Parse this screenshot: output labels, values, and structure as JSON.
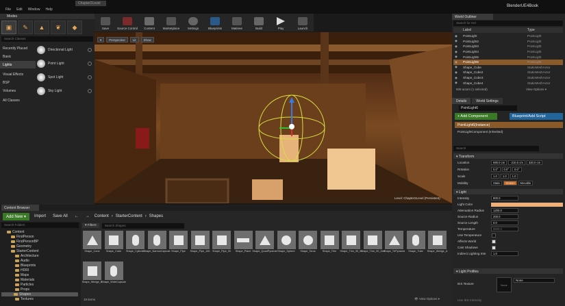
{
  "app": {
    "project_tab": "Chapter2Level",
    "project_name": "BlenderUE4Book",
    "menu": [
      "File",
      "Edit",
      "Window",
      "Help"
    ]
  },
  "toolbar": {
    "buttons": [
      "Save",
      "Source Control",
      "Content",
      "Marketplace",
      "Settings",
      "Blueprints",
      "Matinee",
      "Build",
      "Play",
      "Launch"
    ]
  },
  "modes": {
    "title": "Modes",
    "search_placeholder": "Search Classes",
    "categories": [
      "Recently Placed",
      "Basic",
      "Lights",
      "Visual Effects",
      "BSP",
      "Volumes",
      "All Classes"
    ],
    "lights": [
      "Directional Light",
      "Point Light",
      "Spot Light",
      "Sky Light"
    ]
  },
  "viewport": {
    "perspective": "Perspective",
    "lit": "Lit",
    "show": "Show",
    "level_text": "Level: Chapter2Level (Persistent)"
  },
  "content_browser": {
    "tab": "Content Browser",
    "add_new": "Add New",
    "import": "Import",
    "save_all": "Save All",
    "path": [
      "Content",
      "StarterContent",
      "Shapes"
    ],
    "folder_search": "Search Folders",
    "filters": "Filters",
    "asset_search": "Search Shapes",
    "folders": [
      {
        "name": "Content",
        "depth": 0
      },
      {
        "name": "FirstPerson",
        "depth": 1
      },
      {
        "name": "FirstPersonBP",
        "depth": 1
      },
      {
        "name": "Geometry",
        "depth": 1
      },
      {
        "name": "StarterContent",
        "depth": 1
      },
      {
        "name": "Architecture",
        "depth": 2
      },
      {
        "name": "Audio",
        "depth": 2
      },
      {
        "name": "Blueprints",
        "depth": 2
      },
      {
        "name": "HDRI",
        "depth": 2
      },
      {
        "name": "Maps",
        "depth": 2
      },
      {
        "name": "Materials",
        "depth": 2
      },
      {
        "name": "Particles",
        "depth": 2
      },
      {
        "name": "Props",
        "depth": 2
      },
      {
        "name": "Shapes",
        "depth": 2,
        "selected": true
      },
      {
        "name": "Textures",
        "depth": 2
      }
    ],
    "assets": [
      "Shape_Cone",
      "Shape_Cube",
      "Shape_Cylinder",
      "Shape_NarrowCapsule",
      "Shape_Pipe",
      "Shape_Pipe_180",
      "Shape_Pipe_90",
      "Shape_Plane",
      "Shape_QuadPyramid",
      "Shape_Sphere",
      "Shape_Torus",
      "Shape_Trim",
      "Shape_Trim_90_In",
      "Shape_Trim_90_Out",
      "Shape_TriPyramid",
      "Shape_Tube",
      "Shape_Wedge_A",
      "Shape_Wedge_B",
      "Shape_WideCapsule"
    ],
    "item_count": "19 items",
    "view_options": "View Options"
  },
  "world_outliner": {
    "tab": "World Outliner",
    "search_placeholder": "Search for Hel",
    "col_label": "Label",
    "col_type": "Type",
    "rows": [
      {
        "label": "PointLight",
        "type": "PointLight"
      },
      {
        "label": "PointLight2",
        "type": "PointLight"
      },
      {
        "label": "PointLight3",
        "type": "PointLight"
      },
      {
        "label": "PointLight4",
        "type": "PointLight"
      },
      {
        "label": "PointLight5",
        "type": "PointLight"
      },
      {
        "label": "PointLight6",
        "type": "PointLight",
        "selected": true
      },
      {
        "label": "Shape_Cube",
        "type": "StaticMeshActor"
      },
      {
        "label": "Shape_Cube2",
        "type": "StaticMeshActor"
      },
      {
        "label": "Shape_Cube3",
        "type": "StaticMeshActor"
      },
      {
        "label": "Shape_Cube4",
        "type": "StaticMeshActor"
      }
    ],
    "count": "608 actors (1 selected)",
    "view_options": "View Options"
  },
  "details": {
    "tab": "Details",
    "tab2": "World Settings",
    "name": "PointLight6",
    "add_component": "+ Add Component",
    "blueprint_script": "Blueprint/Add Script",
    "component_instance": "PointLight6(Instance)",
    "component_child": "PointLightComponent (Inherited)",
    "search_placeholder": "Search",
    "transform": {
      "title": "Transform",
      "location": [
        "590.0 cm",
        "-210.0 cm",
        "320.0 cm"
      ],
      "rotation": [
        "0.0°",
        "0.0°",
        "0.0°"
      ],
      "scale": [
        "1.0",
        "1.0",
        "1.0"
      ],
      "mobility": [
        "Static",
        "Station",
        "Movable"
      ]
    },
    "light": {
      "title": "Light",
      "intensity": "800.0",
      "light_color": "",
      "attenuation_radius": "1200.0",
      "source_radius": "200.0",
      "source_length": "0.0",
      "temperature": "6500.0",
      "labels": [
        "Intensity",
        "Light Color",
        "Attenuation Radius",
        "Source Radius",
        "Source Length",
        "Temperature",
        "Use Temperature",
        "Affects World",
        "Cast Shadows",
        "Indirect Lighting Inte"
      ],
      "indirect": "1.0"
    },
    "light_profiles": {
      "title": "Light Profiles",
      "ies_texture": "IES Texture",
      "none": "None",
      "use_ies": "Use IES Intensity"
    },
    "labels": {
      "location": "Location",
      "rotation": "Rotation",
      "scale": "Scale",
      "mobility": "Mobility"
    }
  },
  "colors": {
    "accent_orange": "#8a5a2a",
    "green": "#3a7a26",
    "blue": "#22659b"
  }
}
